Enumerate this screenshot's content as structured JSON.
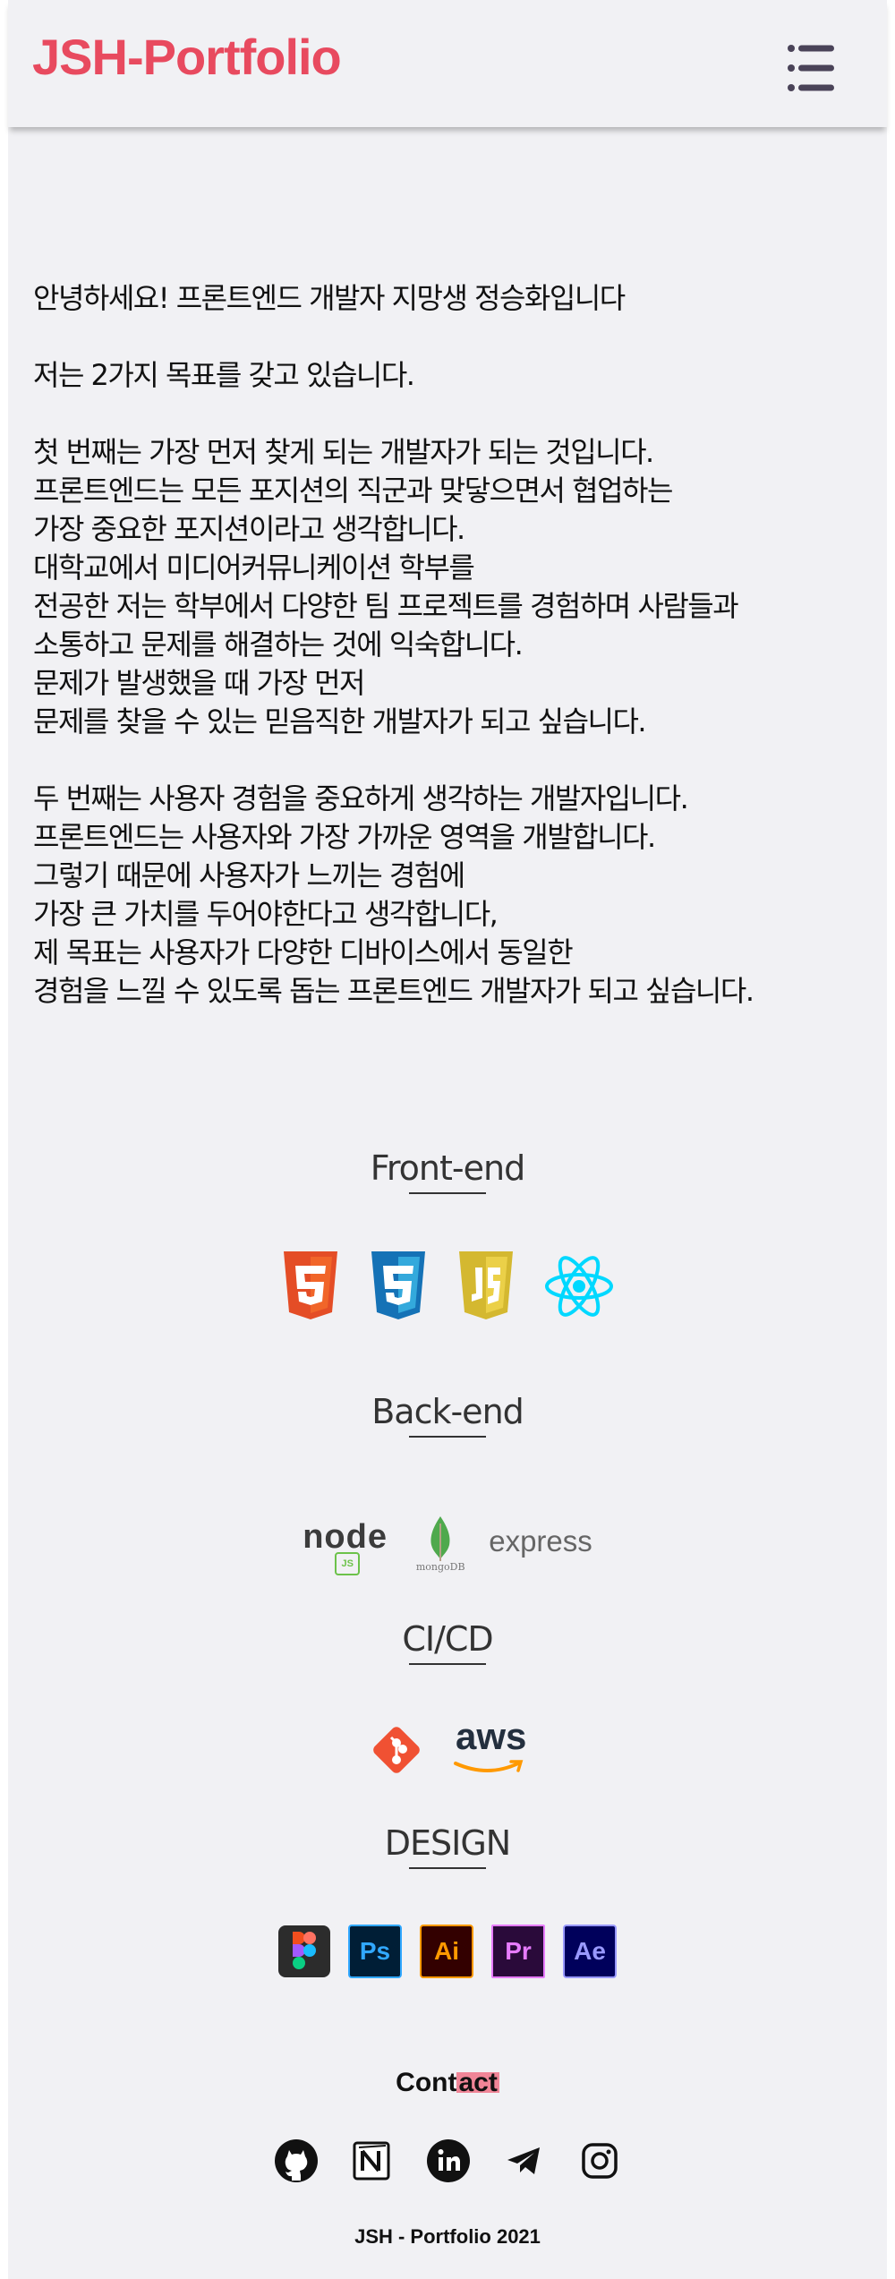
{
  "header": {
    "logo": "JSH-Portfolio",
    "menu_icon": "hamburger-menu-icon"
  },
  "intro": {
    "greeting": "안녕하세요! 프론트엔드 개발자 지망생 정승화입니다",
    "goals": "저는 2가지 목표를 갖고 있습니다.",
    "first": "첫 번째는 가장 먼저 찾게 되는 개발자가 되는 것입니다.\n프론트엔드는 모든 포지션의 직군과 맞닿으면서 협업하는\n가장 중요한 포지션이라고 생각합니다.\n대학교에서 미디어커뮤니케이션 학부를\n전공한 저는 학부에서 다양한 팀 프로젝트를 경험하며 사람들과\n소통하고 문제를 해결하는 것에 익숙합니다.\n문제가 발생했을 때 가장 먼저\n문제를 찾을 수 있는 믿음직한 개발자가 되고 싶습니다.",
    "second": "두 번째는 사용자 경험을 중요하게 생각하는 개발자입니다.\n프론트엔드는 사용자와 가장 가까운 영역을 개발합니다.\n그렇기 때문에 사용자가 느끼는 경험에\n가장 큰 가치를 두어야한다고 생각합니다,\n제 목표는 사용자가 다양한 디바이스에서 동일한\n경험을 느낄 수 있도록 돕는 프론트엔드 개발자가 되고 싶습니다."
  },
  "skills": {
    "frontend": {
      "title": "Front-end",
      "icons": [
        "html5-icon",
        "css3-icon",
        "javascript-icon",
        "react-icon"
      ]
    },
    "backend": {
      "title": "Back-end",
      "icons": [
        "nodejs-icon",
        "mongodb-icon",
        "express-icon"
      ],
      "node_text": "node",
      "node_badge": "JS",
      "mongo_text": "mongoDB",
      "express_text": "express"
    },
    "cicd": {
      "title": "CI/CD",
      "icons": [
        "git-icon",
        "aws-icon"
      ],
      "aws_text": "aws"
    },
    "design": {
      "title": "DESIGN",
      "icons": [
        "figma-icon",
        "photoshop-icon",
        "illustrator-icon",
        "premiere-icon",
        "after-effects-icon"
      ],
      "ps": "Ps",
      "ai": "Ai",
      "pr": "Pr",
      "ae": "Ae"
    }
  },
  "contact": {
    "title_a": "Cont",
    "title_b": "act",
    "links": [
      "github-icon",
      "notion-icon",
      "linkedin-icon",
      "telegram-icon",
      "instagram-icon"
    ]
  },
  "footer": {
    "text": "JSH - Portfolio 2021"
  },
  "colors": {
    "brand": "#e84a5f",
    "background": "#f1f1f4",
    "highlight": "#f08597"
  }
}
